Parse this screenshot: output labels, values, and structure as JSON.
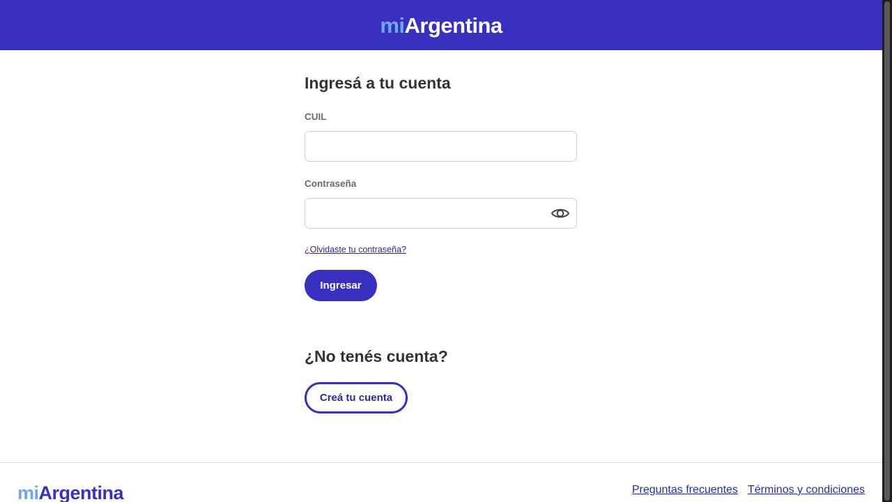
{
  "brand": {
    "prefix": "mi",
    "name": "Argentina"
  },
  "login": {
    "title": "Ingresá a tu cuenta",
    "cuil_label": "CUIL",
    "cuil_value": "",
    "cuil_placeholder": "",
    "password_label": "Contraseña",
    "password_value": "",
    "password_placeholder": "",
    "show_password_icon": "eye-icon",
    "forgot_link": "¿Olvidaste tu contraseña?",
    "submit_label": "Ingresar"
  },
  "signup": {
    "title": "¿No tenés cuenta?",
    "create_label": "Creá tu cuenta"
  },
  "footer": {
    "links": [
      {
        "label": "Preguntas frecuentes"
      },
      {
        "label": "Términos y condiciones"
      }
    ]
  },
  "colors": {
    "primary": "#3730c0",
    "brand_light": "#6fa8ec",
    "link": "#2a2aa0",
    "text": "#333333",
    "label": "#6b6b6b"
  }
}
